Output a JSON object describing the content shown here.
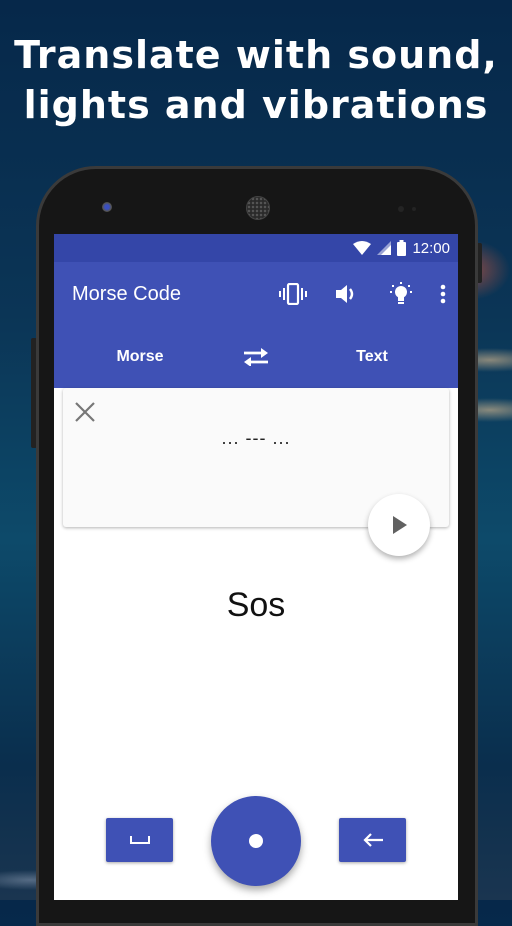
{
  "headline": {
    "line1": "Translate with sound,",
    "line2": "lights and vibrations"
  },
  "status_bar": {
    "time": "12:00",
    "icons": [
      "wifi-icon",
      "signal-icon",
      "battery-icon"
    ]
  },
  "app_bar": {
    "title": "Morse Code",
    "actions": [
      "vibrate-icon",
      "volume-icon",
      "light-bulb-icon",
      "more-vert-icon"
    ]
  },
  "language_bar": {
    "source": "Morse",
    "target": "Text",
    "swap_icon": "swap-horiz-icon"
  },
  "input_card": {
    "value": "... --- ...",
    "clear_icon": "close-icon",
    "play_icon": "play-icon"
  },
  "output": {
    "text": "Sos"
  },
  "keypad": {
    "space_icon": "space-bar-icon",
    "dot_icon": "dot-icon",
    "backspace_icon": "arrow-left-icon"
  },
  "colors": {
    "primary": "#3f51b5",
    "primary_dark": "#3446a8",
    "card": "#fafafa"
  }
}
